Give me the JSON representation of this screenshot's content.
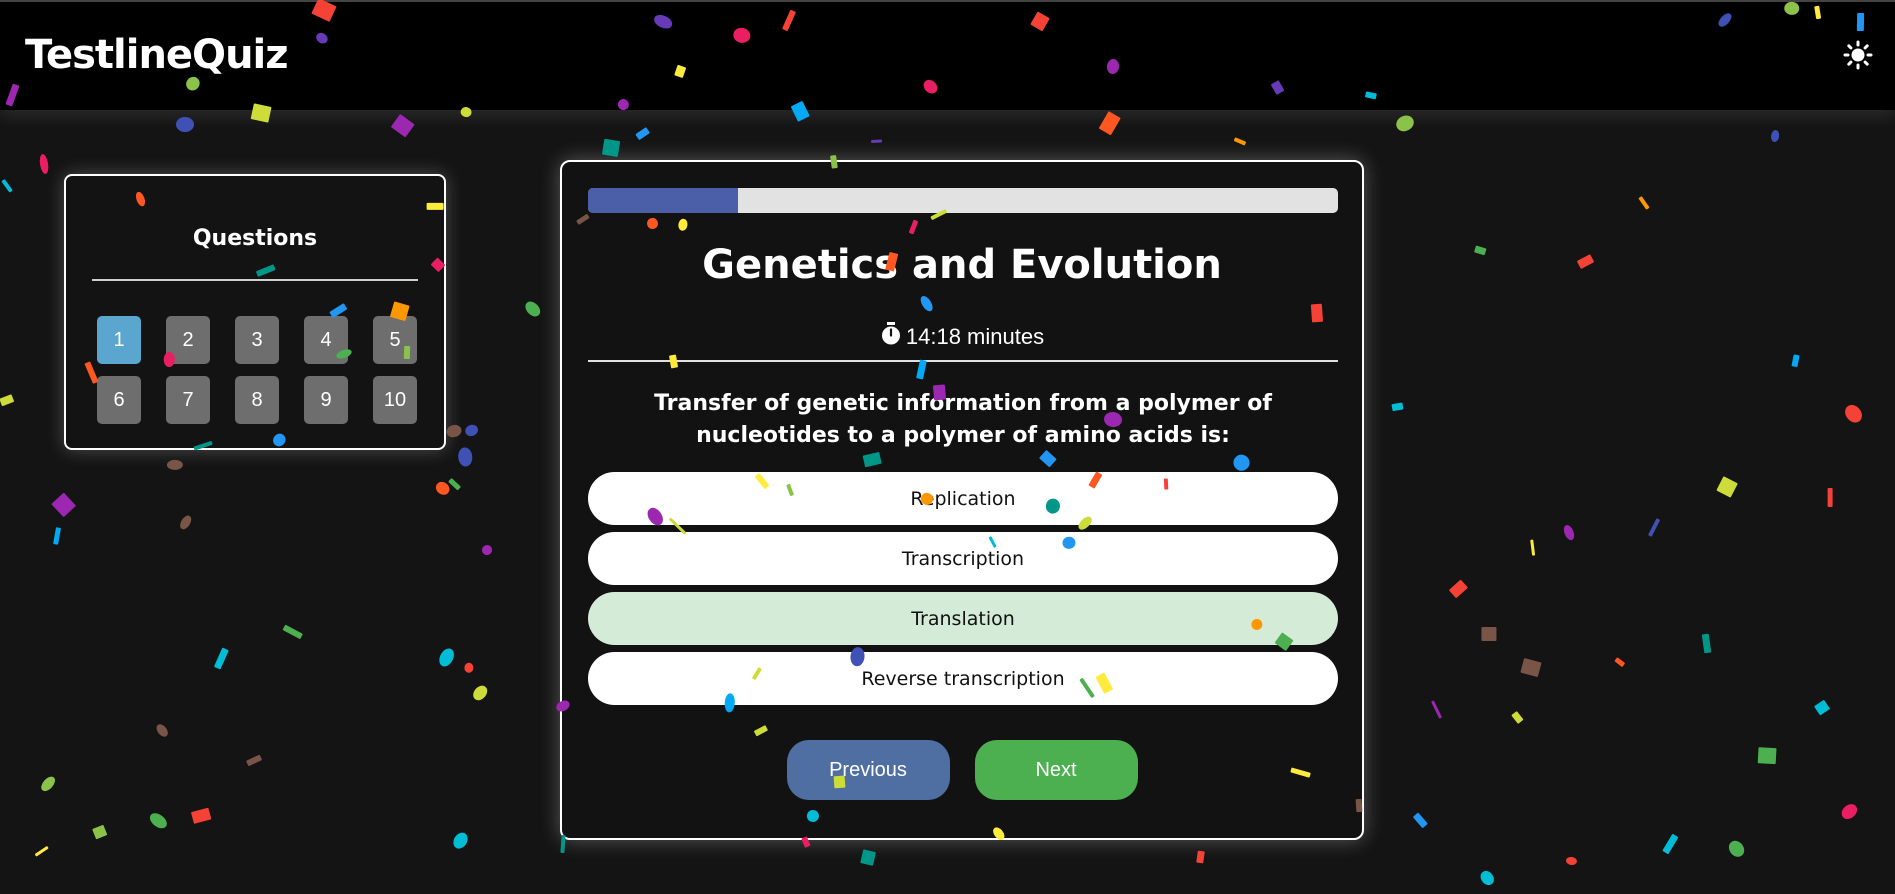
{
  "app": {
    "title": "TestlineQuiz",
    "theme_icon": "sun-icon"
  },
  "sidebar": {
    "title": "Questions",
    "active": 1,
    "items": [
      "1",
      "2",
      "3",
      "4",
      "5",
      "6",
      "7",
      "8",
      "9",
      "10"
    ]
  },
  "quiz": {
    "progress_fraction": 0.2,
    "title": "Genetics and Evolution",
    "timer_icon": "stopwatch-icon",
    "timer_text": "14:18 minutes",
    "question": "Transfer of genetic information from a polymer of nucleotides to a polymer of amino acids is:",
    "options": [
      "Replication",
      "Transcription",
      "Translation",
      "Reverse transcription"
    ],
    "selected_option_index": 2,
    "prev_label": "Previous",
    "next_label": "Next"
  },
  "colors": {
    "background": "#141414",
    "header": "#000000",
    "progress_fill": "#4b5fa8",
    "active_question": "#5aa6cf",
    "selected_option": "#d4ebd8",
    "previous_button": "#4f6fa3",
    "next_button": "#4caf50"
  },
  "decorations": {
    "confetti_colors": [
      "#e91e63",
      "#2196f3",
      "#ffeb3b",
      "#4caf50",
      "#9c27b0",
      "#ff5722",
      "#00bcd4",
      "#cddc39",
      "#ff9800",
      "#795548",
      "#3f51b5",
      "#009688",
      "#f44336",
      "#673ab7",
      "#03a9f4",
      "#8bc34a"
    ]
  }
}
